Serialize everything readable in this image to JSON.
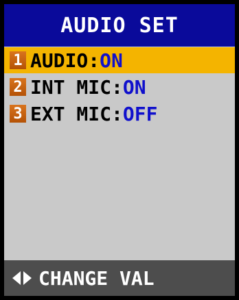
{
  "title": "AUDIO SET",
  "items": [
    {
      "number": "1",
      "label": "AUDIO",
      "separator": ":",
      "value": "ON"
    },
    {
      "number": "2",
      "label": "INT MIC",
      "separator": ":",
      "value": "ON"
    },
    {
      "number": "3",
      "label": "EXT MIC",
      "separator": ":",
      "value": "OFF"
    }
  ],
  "footer": {
    "left_arrow_icon": "arrow-left-icon",
    "right_arrow_icon": "arrow-right-icon",
    "text": "CHANGE VAL"
  },
  "colors": {
    "title_bg": "#0a0a9a",
    "selected_bg": "#f4b400",
    "value_text": "#1010cc",
    "badge": "#c96212",
    "footer_bg": "#4d4d4d",
    "screen_bg": "#c9c9c9"
  }
}
